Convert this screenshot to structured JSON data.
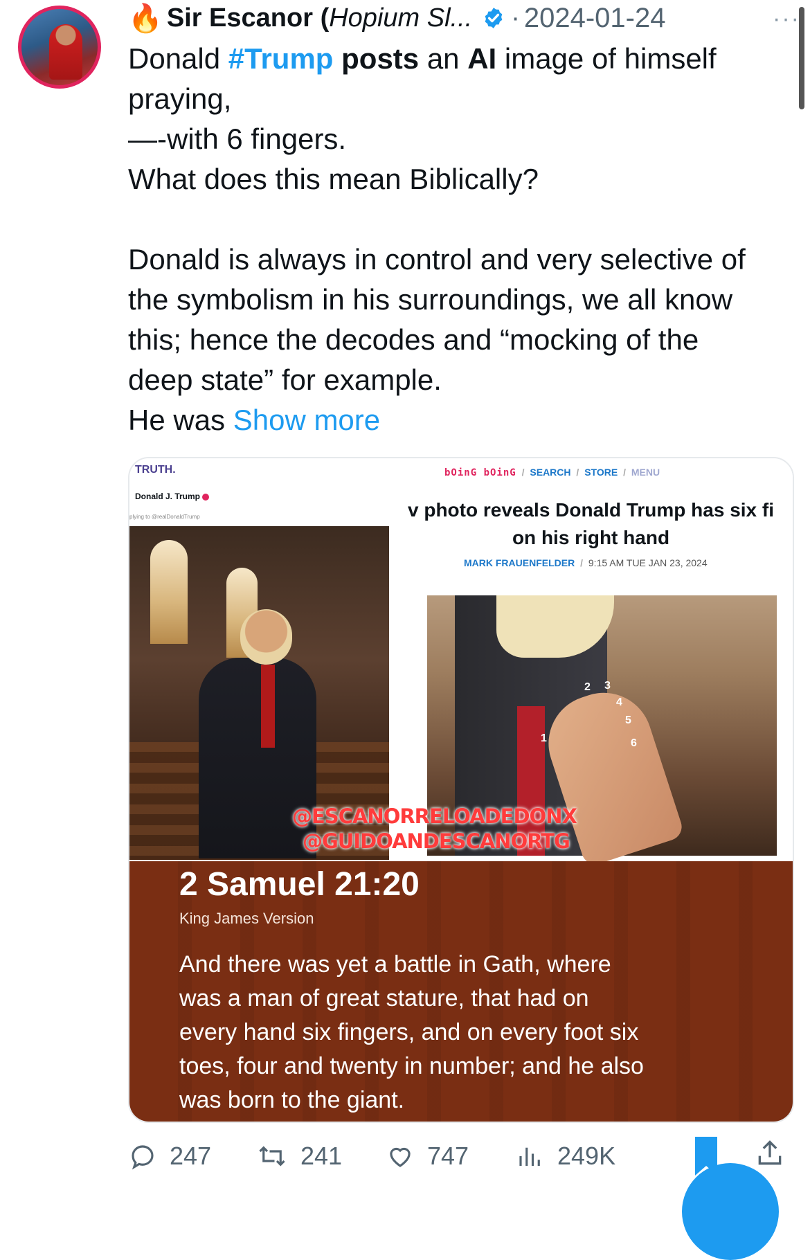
{
  "author": {
    "display_name": "Sir Escanor (",
    "display_name_tail": "Hopium Sl...",
    "fire_icon": "🔥",
    "verified_color": "#1d9bf0",
    "separator": "·",
    "date": "2024-01-24",
    "more": "···"
  },
  "tweet": {
    "l1_a": "Donald ",
    "l1_hashtag": "#Trump",
    "l1_b": " posts",
    "l1_c": " an ",
    "l1_d": "AI",
    "l1_e": " image of himself",
    "l2": "praying,",
    "l3": "—-with 6 fingers.",
    "l4": "What does this mean Biblically?",
    "l5": "Donald is always in control and very selective of",
    "l6": "the symbolism in his surroundings, we all know",
    "l7": "this; hence the decodes and “mocking of the",
    "l8": "deep state” for example.",
    "l9": "He was ",
    "show_more": "Show more"
  },
  "media": {
    "truth_logo": "TRUTH.",
    "truth_user": "Donald J. Trump",
    "truth_reply": "plying to @realDonaldTrump",
    "bb_logo": "bOinG bOinG",
    "bb_search": "SEARCH",
    "bb_store": "STORE",
    "bb_menu": "MENU",
    "bb_slash": "/",
    "bb_title_1": "v photo reveals Donald Trump has six fi",
    "bb_title_2": "on his right hand",
    "bb_author": "MARK FRAUENFELDER",
    "bb_time": "9:15 AM TUE JAN 23, 2024",
    "finger_numbers": [
      "1",
      "2",
      "3",
      "4",
      "5",
      "6"
    ],
    "watermark_1": "@ESCANORRELOADEDONX",
    "watermark_2": "@GUIDOANDESCANORTG",
    "verse_ref": "2 Samuel 21:20",
    "verse_version": "King James Version",
    "verse_text_1": "And there was yet a battle in Gath, where",
    "verse_text_2": "was a man of great stature, that had on",
    "verse_text_3": "every hand six fingers, and on every foot six",
    "verse_text_4": "toes, four and twenty in number; and he also",
    "verse_text_5": "was born to the giant."
  },
  "actions": {
    "replies": "247",
    "retweets": "241",
    "likes": "747",
    "views": "249K"
  },
  "colors": {
    "accent": "#1d9bf0",
    "verse_bg": "#7a2e13",
    "watermark": "#ff3b3b"
  }
}
